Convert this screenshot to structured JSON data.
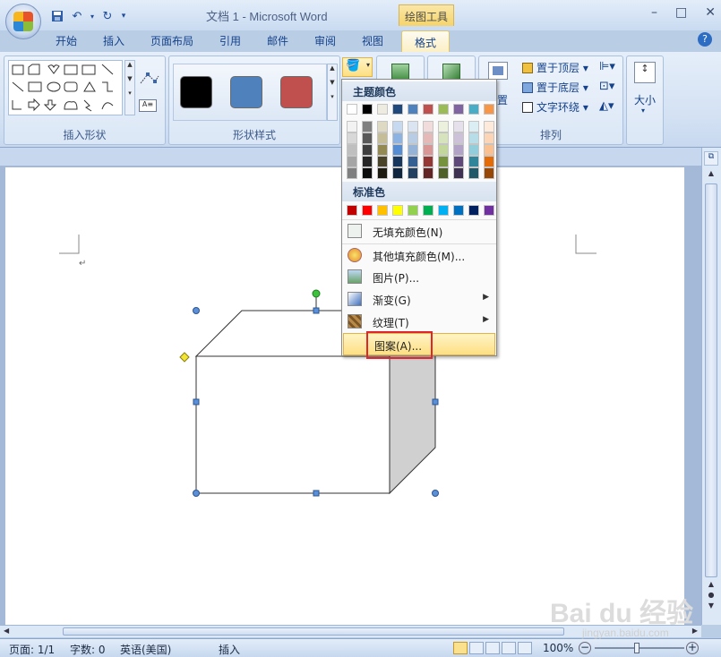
{
  "window": {
    "title": "文档 1 - Microsoft Word",
    "context_title": "绘图工具",
    "minimize": "–",
    "restore": "□",
    "close": "✕"
  },
  "tabs": [
    {
      "label": "开始"
    },
    {
      "label": "插入"
    },
    {
      "label": "页面布局"
    },
    {
      "label": "引用"
    },
    {
      "label": "邮件"
    },
    {
      "label": "审阅"
    },
    {
      "label": "视图"
    },
    {
      "label": "格式"
    }
  ],
  "ribbon": {
    "groups": {
      "insert_shapes": "插入形状",
      "shape_styles": "形状样式",
      "arrange": "排列",
      "size_label": "大小"
    },
    "arrange": {
      "bring_front": "置于顶层",
      "send_back": "置于底层",
      "text_wrap": "文字环绕",
      "position_partial": "置"
    },
    "style_swatches": [
      {
        "color": "#000000"
      },
      {
        "color": "#4f81bd"
      },
      {
        "color": "#c0504d"
      }
    ]
  },
  "fill_menu": {
    "theme_colors_header": "主题颜色",
    "standard_colors_header": "标准色",
    "theme_top_row": [
      "#ffffff",
      "#000000",
      "#eeece1",
      "#1f497d",
      "#4f81bd",
      "#c0504d",
      "#9bbb59",
      "#8064a2",
      "#4bacc6",
      "#f79646"
    ],
    "theme_shades": [
      [
        "#f2f2f2",
        "#d8d8d8",
        "#bfbfbf",
        "#a5a5a5",
        "#7f7f7f"
      ],
      [
        "#7f7f7f",
        "#595959",
        "#3f3f3f",
        "#262626",
        "#0c0c0c"
      ],
      [
        "#ddd9c3",
        "#c4bd97",
        "#938953",
        "#494429",
        "#1d1b10"
      ],
      [
        "#c6d9f0",
        "#8db3e2",
        "#548dd4",
        "#17365d",
        "#0f243e"
      ],
      [
        "#dbe5f1",
        "#b8cce4",
        "#95b3d7",
        "#366092",
        "#244061"
      ],
      [
        "#f2dcdb",
        "#e5b9b7",
        "#d99694",
        "#953734",
        "#632423"
      ],
      [
        "#ebf1dd",
        "#d7e3bc",
        "#c3d69b",
        "#76923c",
        "#4f6128"
      ],
      [
        "#e5e0ec",
        "#ccc1d9",
        "#b2a2c7",
        "#5f497a",
        "#3f3151"
      ],
      [
        "#dbeef3",
        "#b7dde8",
        "#92cddc",
        "#31859b",
        "#205867"
      ],
      [
        "#fdeada",
        "#fbd5b5",
        "#fac08f",
        "#e36c09",
        "#974806"
      ]
    ],
    "standard_colors": [
      "#c00000",
      "#ff0000",
      "#ffc000",
      "#ffff00",
      "#92d050",
      "#00b050",
      "#00b0f0",
      "#0070c0",
      "#002060",
      "#7030a0"
    ],
    "items": [
      {
        "label": "无填充颜色(N)",
        "icon": "no-fill-icon"
      },
      {
        "label": "其他填充颜色(M)...",
        "icon": "color-palette-icon"
      },
      {
        "label": "图片(P)...",
        "icon": "picture-icon"
      },
      {
        "label": "渐变(G)",
        "icon": "gradient-icon",
        "submenu": true
      },
      {
        "label": "纹理(T)",
        "icon": "texture-icon",
        "submenu": true
      },
      {
        "label": "图案(A)...",
        "icon": "pattern-icon",
        "highlighted": true
      }
    ]
  },
  "document": {
    "paragraph_mark": "↵"
  },
  "status": {
    "page": "页面: 1/1",
    "words": "字数: 0",
    "language": "英语(美国)",
    "mode": "插入",
    "zoom": "100%",
    "zoom_out": "−",
    "zoom_in": "+"
  },
  "watermark": {
    "logo": "Bai du 经验",
    "url": "jingyan.baidu.com"
  },
  "colors": {
    "highlight_border": "#e0262c",
    "arrow": "#e0262c"
  }
}
